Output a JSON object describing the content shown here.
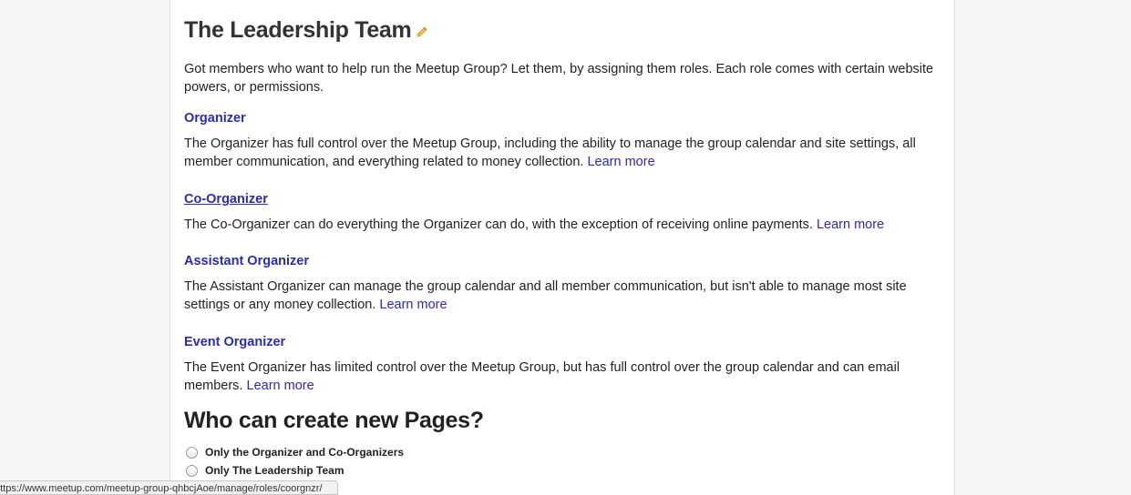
{
  "header": {
    "title": "The Leadership Team"
  },
  "intro": "Got members who want to help run the Meetup Group? Let them, by assigning them roles. Each role comes with certain website powers, or permissions.",
  "roles": [
    {
      "name": "Organizer",
      "description": "The Organizer has full control over the Meetup Group, including the ability to manage the group calendar and site settings, all member communication, and everything related to money collection.",
      "link": "Learn more"
    },
    {
      "name": "Co-Organizer",
      "description": "The Co-Organizer can do everything the Organizer can do, with the exception of receiving online payments.",
      "link": "Learn more"
    },
    {
      "name": "Assistant Organizer",
      "description": "The Assistant Organizer can manage the group calendar and all member communication, but isn't able to manage most site settings or any money collection.",
      "link": "Learn more"
    },
    {
      "name": "Event Organizer",
      "description": "The Event Organizer has limited control over the Meetup Group, but has full control over the group calendar and can email members.",
      "link": "Learn more"
    }
  ],
  "pages_section": {
    "title": "Who can create new Pages?",
    "options": [
      "Only the Organizer and Co-Organizers",
      "Only The Leadership Team"
    ]
  },
  "status_bar": {
    "url": "https://www.meetup.com/meetup-group-qhbcjAoe/manage/roles/coorgnzr/"
  },
  "colors": {
    "link": "#2b2bb0",
    "heading": "#333333",
    "pencil": "#e0a42a"
  }
}
